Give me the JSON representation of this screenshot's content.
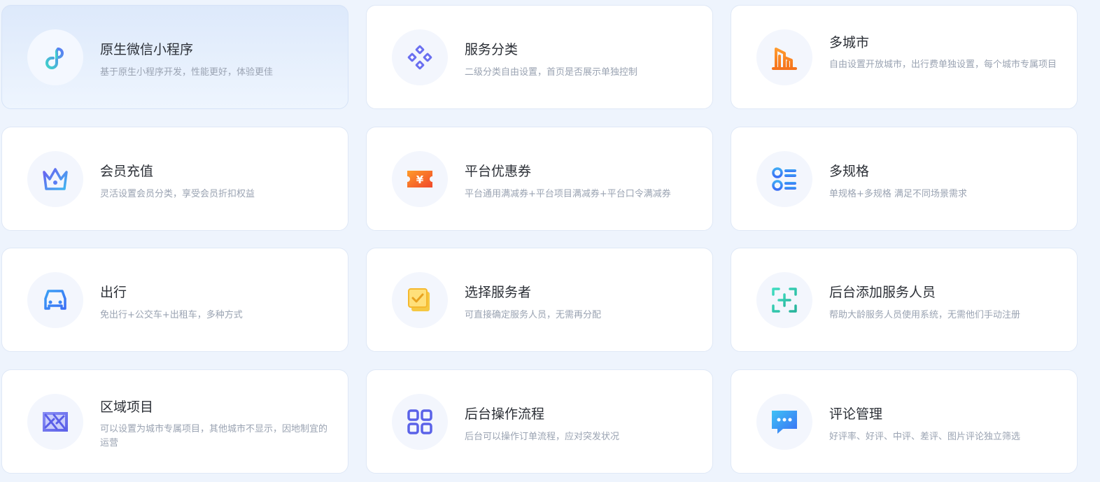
{
  "features": [
    {
      "icon": "link-icon",
      "title": "原生微信小程序",
      "desc": "基于原生小程序开发，性能更好，体验更佳",
      "active": true
    },
    {
      "icon": "category-diamond-icon",
      "title": "服务分类",
      "desc": "二级分类自由设置，首页是否展示单独控制"
    },
    {
      "icon": "city-building-icon",
      "title": "多城市",
      "desc": "自由设置开放城市，出行费单独设置，每个城市专属项目"
    },
    {
      "icon": "crown-icon",
      "title": "会员充值",
      "desc": "灵活设置会员分类，享受会员折扣权益"
    },
    {
      "icon": "coupon-ticket-icon",
      "title": "平台优惠券",
      "desc": "平台通用满减券+平台项目满减券+平台口令满减券"
    },
    {
      "icon": "spec-list-icon",
      "title": "多规格",
      "desc": "单规格+多规格 满足不同场景需求"
    },
    {
      "icon": "car-icon",
      "title": "出行",
      "desc": "免出行+公交车+出租车，多种方式"
    },
    {
      "icon": "select-checkbox-icon",
      "title": "选择服务者",
      "desc": "可直接确定服务人员，无需再分配"
    },
    {
      "icon": "add-staff-icon",
      "title": "后台添加服务人员",
      "desc": "帮助大龄服务人员使用系统，无需他们手动注册"
    },
    {
      "icon": "area-map-icon",
      "title": "区域项目",
      "desc": "可以设置为城市专属项目，其他城市不显示，因地制宜的运营"
    },
    {
      "icon": "workflow-grid-icon",
      "title": "后台操作流程",
      "desc": "后台可以操作订单流程，应对突发状况"
    },
    {
      "icon": "comment-chat-icon",
      "title": "评论管理",
      "desc": "好评率、好评、中评、差评、图片评论独立筛选"
    }
  ]
}
